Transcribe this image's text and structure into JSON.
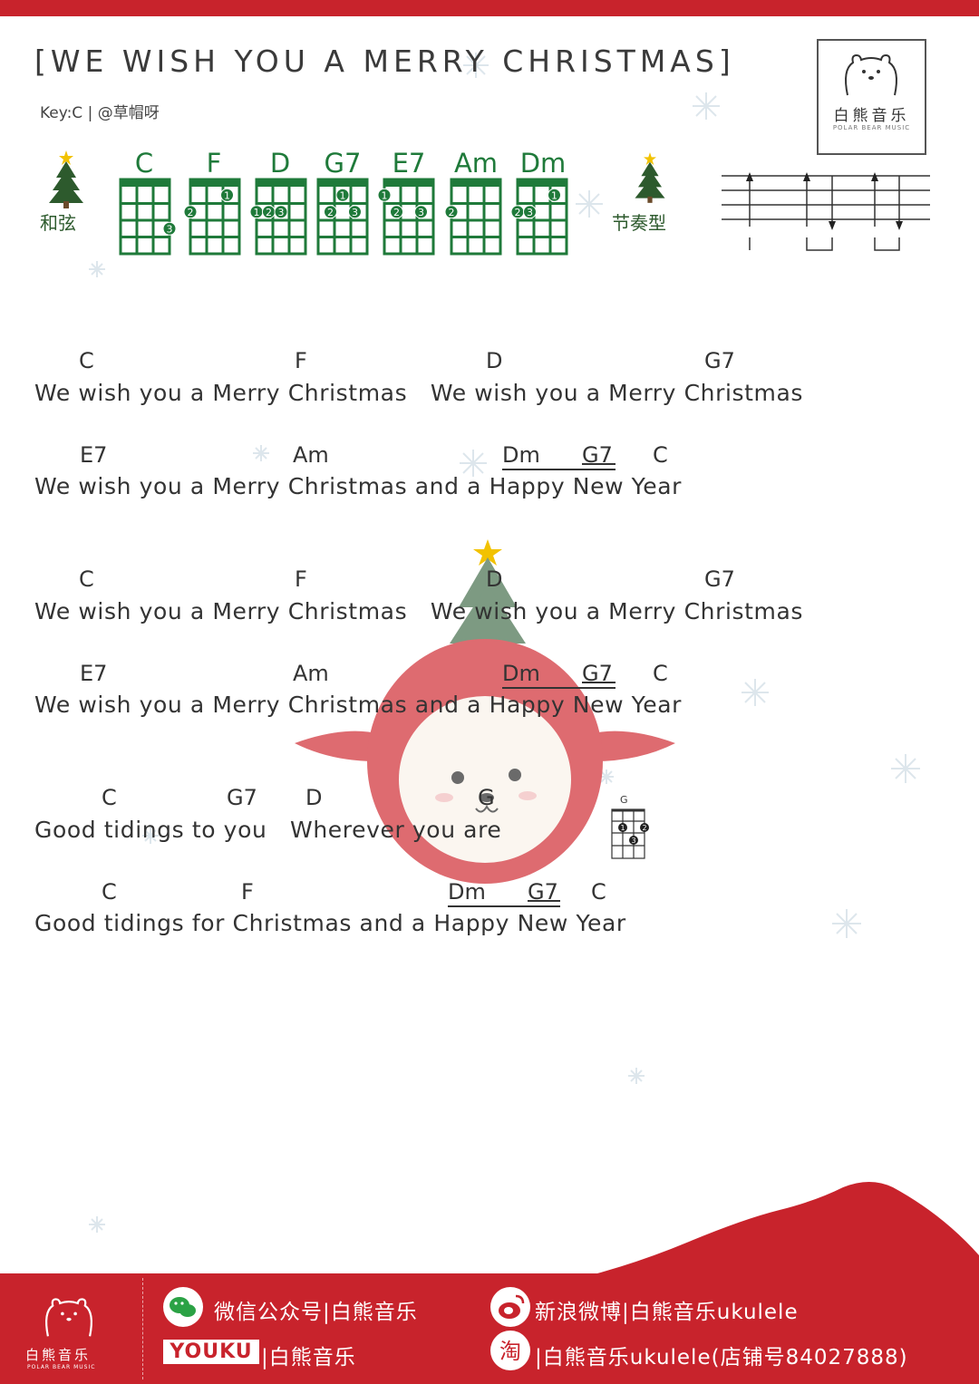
{
  "title": "[WE WISH YOU A MERRY CHRISTMAS]",
  "meta": "Key:C | @草帽呀",
  "logo": {
    "name": "白熊音乐",
    "subtitle": "POLAR BEAR MUSIC"
  },
  "chords_label": "和弦",
  "strum_label": "节奏型",
  "chord_names": [
    "C",
    "F",
    "D",
    "G7",
    "E7",
    "Am",
    "Dm"
  ],
  "inline_chord_name": "G",
  "verses": [
    {
      "chords": [
        "C",
        "F",
        "D",
        "G7"
      ],
      "lyric": "We wish you a Merry Christmas   We wish you a Merry Christmas"
    },
    {
      "chords": [
        "E7",
        "Am",
        "Dm",
        "G7",
        "C"
      ],
      "lyric": "We wish you a Merry Christmas and a Happy New Year"
    },
    {
      "chords": [
        "C",
        "F",
        "D",
        "G7"
      ],
      "lyric": "We wish you a Merry Christmas   We wish you a Merry Christmas"
    },
    {
      "chords": [
        "E7",
        "Am",
        "Dm",
        "G7",
        "C"
      ],
      "lyric": "We wish you a Merry Christmas and a Happy New Year"
    },
    {
      "chords": [
        "C",
        "G7",
        "D",
        "G"
      ],
      "lyric": "Good tidings to you   Wherever you are"
    },
    {
      "chords": [
        "C",
        "F",
        "Dm",
        "G7",
        "C"
      ],
      "lyric": "Good tidings for Christmas and a Happy New Year"
    }
  ],
  "footer": {
    "logo_name": "白熊音乐",
    "logo_sub": "POLAR BEAR MUSIC",
    "wechat": "微信公众号|白熊音乐",
    "weibo": "新浪微博|白熊音乐ukulele",
    "youku_brand": "YOUKU",
    "youku": "|白熊音乐",
    "taobao": "|白熊音乐ukulele(店铺号84027888)"
  },
  "colors": {
    "accent_red": "#c8232c",
    "chord_green": "#1f7a3a",
    "tree_green": "#2d5a2d"
  }
}
